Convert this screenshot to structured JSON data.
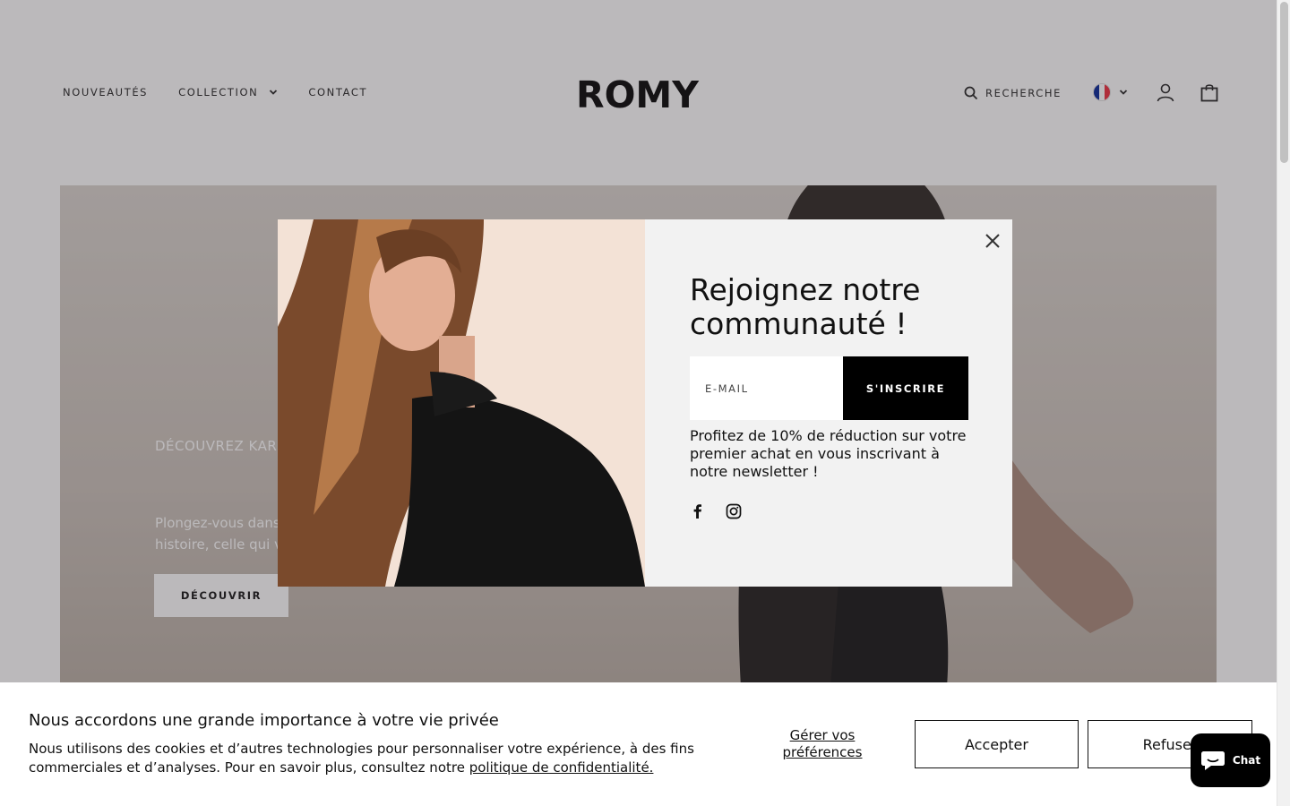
{
  "header": {
    "nav": [
      {
        "label": "NOUVEAUTÉS"
      },
      {
        "label": "COLLECTION"
      },
      {
        "label": "CONTACT"
      }
    ],
    "logo": "ROMY",
    "search_label": "RECHERCHE"
  },
  "hero": {
    "eyebrow": "DÉCOUVREZ KARI",
    "text_line1": "Plongez-vous dans",
    "text_line2": "histoire, celle qui v",
    "button_label": "DÉCOUVRIR"
  },
  "popup": {
    "title": "Rejoignez notre communauté !",
    "email_placeholder": "E-MAIL",
    "subscribe_label": "S'INSCRIRE",
    "description": "Profitez de 10% de réduction sur votre premier achat en vous inscrivant à notre newsletter !"
  },
  "cookie": {
    "title": "Nous accordons une grande importance à votre vie privée",
    "text": "Nous utilisons des cookies et d’autres technologies pour personnaliser votre expérience, à des fins commerciales et d’analyses. Pour en savoir plus, consultez notre ",
    "link": "politique de confidentialité.",
    "prefs_label": "Gérer vos préférences",
    "accept_label": "Accepter",
    "refuse_label": "Refuser"
  },
  "chat": {
    "label": "Chat"
  },
  "colors": {
    "overlay": "#3c373c",
    "popup_bg": "#f2f2f2",
    "button_dark": "#000000",
    "flag_blue": "#002395",
    "flag_red": "#ed2939"
  }
}
